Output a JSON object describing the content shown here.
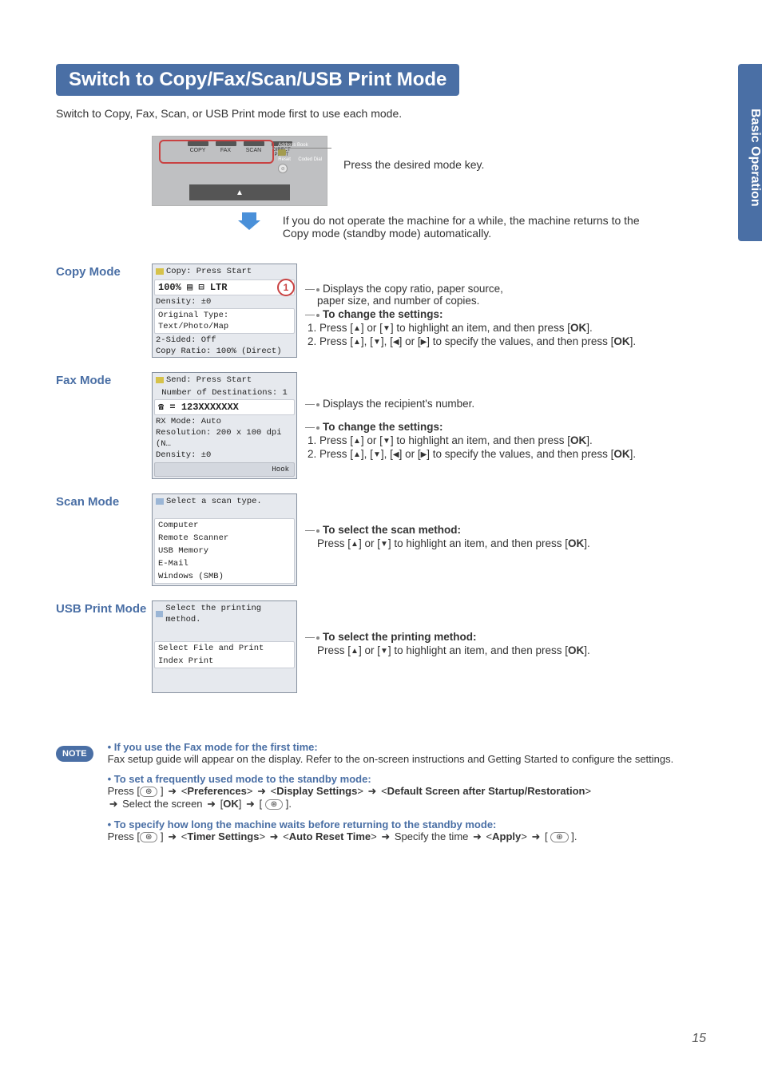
{
  "sideTab": "Basic Operation",
  "title": "Switch to Copy/Fax/Scan/USB Print Mode",
  "intro": "Switch to Copy, Fax, Scan, or USB Print mode first to use each mode.",
  "panel": {
    "keys": [
      "COPY",
      "FAX",
      "SCAN",
      "DIRECT PRINT"
    ],
    "rightLabels": {
      "addressBook": "Address Book",
      "reset": "Reset",
      "codedDial": "Coded Dial"
    },
    "caption": "Press the desired mode key."
  },
  "flow": "If you do not operate the machine for a while, the machine returns to the Copy mode (standby mode) automatically.",
  "modes": {
    "copy": {
      "label": "Copy Mode",
      "lcd": {
        "header": "Copy: Press Start",
        "big": "100% ▤ ⊟ LTR",
        "ring": "1",
        "rows": [
          "Density: ±0",
          "Original Type: Text/Photo/Map",
          "2-Sided: Off",
          "Copy Ratio: 100% (Direct)"
        ]
      },
      "desc1a": "Displays the copy ratio, paper source,",
      "desc1b": "paper size, and number of copies.",
      "changeHdr": "To change the settings:",
      "step1a": "Press [",
      "step1b": "] or [",
      "step1c": "] to highlight an item, and then press [",
      "ok": "OK",
      "step1d": "].",
      "step2a": "Press [",
      "step2b": "], [",
      "step2c": "], [",
      "step2d": "] or [",
      "step2e": "] to specify the values, and then press [",
      "step2f": "]."
    },
    "fax": {
      "label": "Fax Mode",
      "lcd": {
        "header": "Send: Press Start",
        "sub": "Number of Destinations: 1",
        "big": "☎ = 123XXXXXXX",
        "rows": [
          "RX Mode: Auto",
          "Resolution: 200 x 100 dpi (N…",
          "Density: ±0"
        ],
        "hook": "Hook"
      },
      "desc1": "Displays the recipient's number.",
      "changeHdr": "To change the settings:"
    },
    "scan": {
      "label": "Scan Mode",
      "lcd": {
        "header": "Select a scan type.",
        "items": [
          "Computer",
          "Remote Scanner",
          "USB Memory",
          "E-Mail",
          "Windows (SMB)"
        ]
      },
      "selectHdr": "To select the scan method:",
      "step": "] to highlight an item, and then press ["
    },
    "usb": {
      "label": "USB Print Mode",
      "lcd": {
        "header": "Select the printing method.",
        "items": [
          "Select File and Print",
          "Index Print"
        ]
      },
      "selectHdr": "To select the printing method:"
    }
  },
  "notes": {
    "badge": "NOTE",
    "items": [
      {
        "title": "If you use the Fax mode for the first time:",
        "detail": "Fax setup guide will appear on the display. Refer to the on-screen instructions and Getting Started to configure the settings."
      },
      {
        "title": "To set a frequently used mode to the standby mode:",
        "pathPrefix": "Press [",
        "pathTokens": [
          "Preferences",
          "Display Settings",
          "Default Screen after Startup/Restoration"
        ],
        "line2a": " Select the screen ",
        "ok": "OK"
      },
      {
        "title": "To specify how long the machine waits before returning to the standby mode:",
        "pathTokens": [
          "Timer Settings",
          "Auto Reset Time"
        ],
        "mid": " Specify the time ",
        "apply": "Apply"
      }
    ]
  },
  "pageNumber": "15"
}
